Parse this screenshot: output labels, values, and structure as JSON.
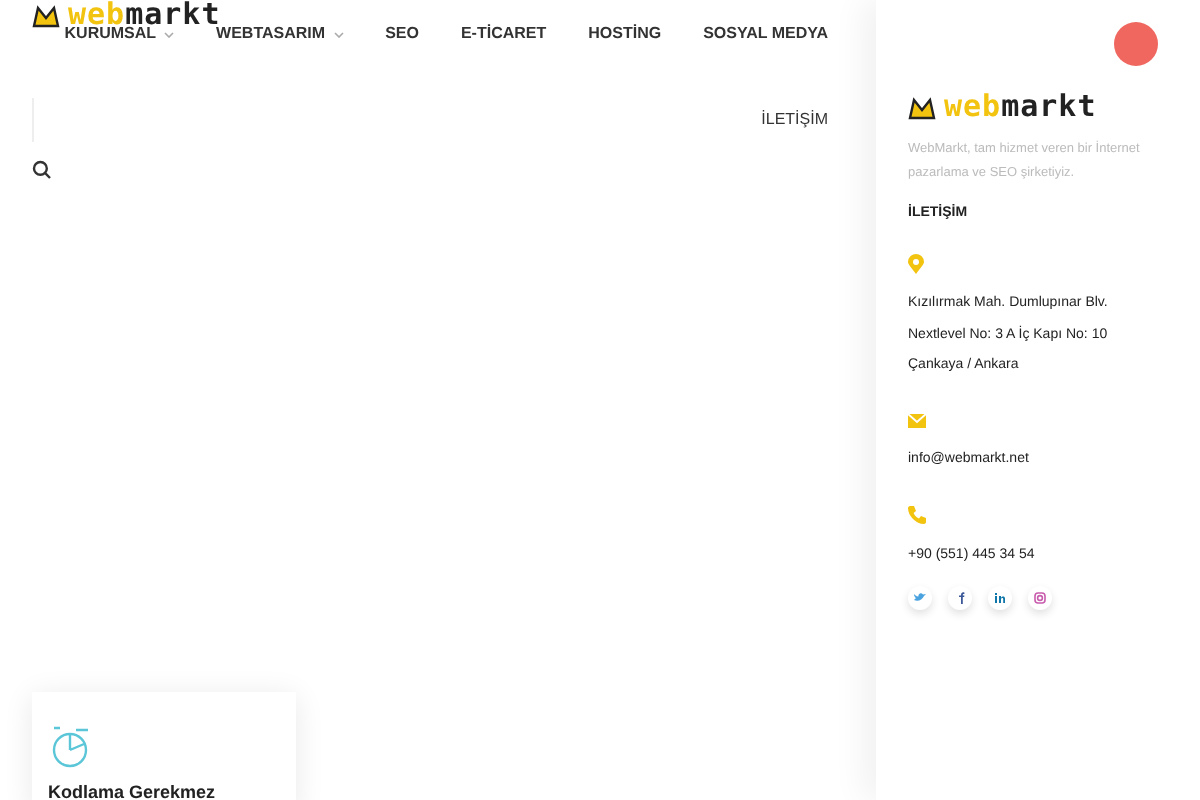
{
  "header": {
    "logo": "webmarkt",
    "nav": [
      {
        "label": "KURUMSAL",
        "dropdown": true
      },
      {
        "label": "WEBTASARIM",
        "dropdown": true
      },
      {
        "label": "SEO",
        "dropdown": false
      },
      {
        "label": "E-TİCARET",
        "dropdown": false
      },
      {
        "label": "HOSTİNG",
        "dropdown": false
      },
      {
        "label": "SOSYAL MEDYA",
        "dropdown": false
      }
    ],
    "contact_link": "İLETİŞİM"
  },
  "feature_card": {
    "title": "Kodlama Gerekmez"
  },
  "side_panel": {
    "logo": "webmarkt",
    "description": "WebMarkt, tam hizmet veren bir İnternet pazarlama ve SEO şirketiyiz.",
    "contact_title": "İLETİŞİM",
    "contacts": [
      {
        "kind": "address",
        "lines": [
          "Kızılırmak Mah. Dumlupınar Blv.",
          "Nextlevel No: 3 A İç Kapı No: 10",
          "Çankaya / Ankara"
        ]
      },
      {
        "kind": "email",
        "lines": [
          "info@webmarkt.net"
        ]
      },
      {
        "kind": "phone",
        "lines": [
          "+90 (551) 445 34 54"
        ]
      }
    ],
    "social": [
      {
        "kind": "twitter"
      },
      {
        "kind": "facebook"
      },
      {
        "kind": "linkedin"
      },
      {
        "kind": "instagram"
      }
    ]
  }
}
